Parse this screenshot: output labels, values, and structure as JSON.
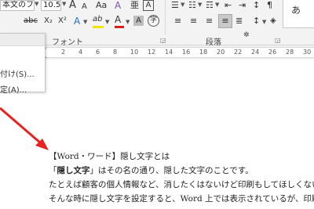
{
  "ribbon": {
    "font_name": "本文のフ",
    "font_size": "10.5",
    "font_group_label": "フォント",
    "paragraph_group_label": "段落",
    "grow_font_label": "A",
    "shrink_font_label": "A",
    "change_case_label": "Aa",
    "clear_format_label": "A",
    "phonetic_label": "亜",
    "border_char_label": "A",
    "strike_label": "abc",
    "sub_label": "X₂",
    "sup_label": "X²",
    "effects_label": "A",
    "highlight_label": "ab",
    "font_color_label": "A",
    "shading_label": "A",
    "enclosed_label": "字",
    "styles_preview": "あ",
    "highlight_color": "#f2e600",
    "font_color": "#d61f1f"
  },
  "ruler": {
    "numbers": [
      "2",
      "4",
      "6",
      "8",
      "10",
      "12",
      "14",
      "16",
      "18",
      "20",
      "22",
      "24",
      "26",
      "28",
      "30"
    ]
  },
  "menu": {
    "item1": "付け(S)...",
    "item2": "定(A)..."
  },
  "document": {
    "line1": "【Word・ワード】隠し文字とは",
    "line2_open": "「",
    "line2_bold": "隠し文字",
    "line2_rest": "」はその名の通り、隠した文字のことです。",
    "line3": "たとえば顧客の個人情報など、消したくはないけど印刷もしてほしくない",
    "line4": "そんな時に隠し文字を設定すると、Word 上では表示されているが、印刷"
  },
  "colors": {
    "arrow": "#e8231f",
    "ribbon_bg": "#f3f3f3"
  }
}
